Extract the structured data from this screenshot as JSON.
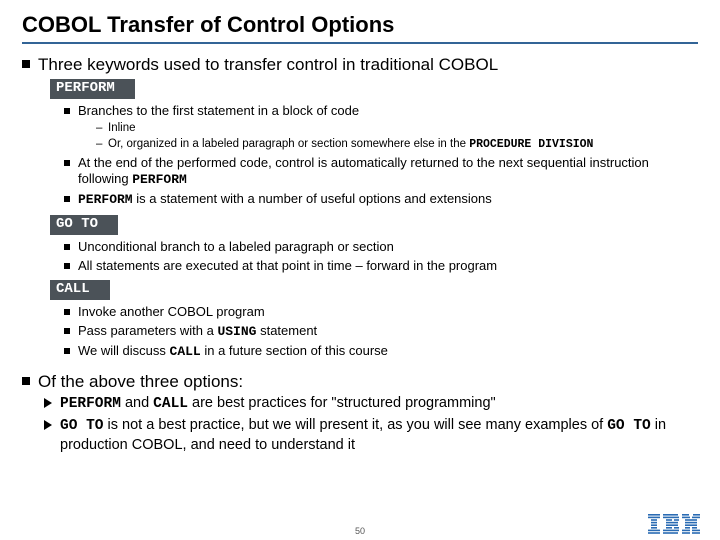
{
  "title": "COBOL  Transfer of Control Options",
  "main_intro": "Three keywords used to transfer control in traditional COBOL",
  "perform": {
    "kw": "PERFORM",
    "b1": "Branches to the first statement in a block of code",
    "sub1": "Inline",
    "sub2_a": "Or, organized in a labeled paragraph or section somewhere else in the ",
    "sub2_b": "PROCEDURE DIVISION",
    "b2_a": "At the end of the performed code, control is automatically returned to the next sequential instruction following ",
    "b2_b": "PERFORM",
    "b3_a": "PERFORM",
    "b3_b": " is a statement with a number of useful options and extensions"
  },
  "goto": {
    "kw": "GO TO",
    "b1": "Unconditional branch to a labeled paragraph or section",
    "b2": "All statements are executed at that point in time – forward in the program"
  },
  "call": {
    "kw": "CALL",
    "b1": "Invoke another COBOL program",
    "b2_a": "Pass parameters with a ",
    "b2_b": "USING",
    "b2_c": " statement",
    "b3_a": "We will discuss ",
    "b3_b": "CALL",
    "b3_c": " in a future section of this course"
  },
  "summary": {
    "heading": "Of the above three options:",
    "a1_a": "PERFORM",
    "a1_b": " and ",
    "a1_c": "CALL",
    "a1_d": " are best practices for \"structured programming\"",
    "a2_a": "GO TO",
    "a2_b": " is not a best practice, but we will present it, as you will see many examples of ",
    "a2_c": "GO TO",
    "a2_d": " in production COBOL, and need to understand it"
  },
  "page_number": "50",
  "logo_alt": "IBM"
}
